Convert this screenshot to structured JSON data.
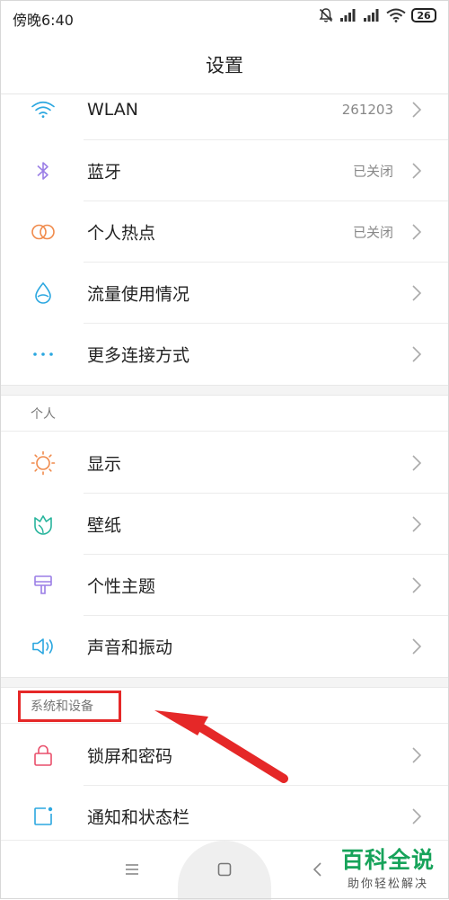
{
  "status_bar": {
    "time": "傍晚6:40",
    "battery": "26"
  },
  "header": {
    "title": "设置"
  },
  "sections": [
    {
      "header": "",
      "items": [
        {
          "icon": "wifi-icon",
          "label": "WLAN",
          "value": "261203"
        },
        {
          "icon": "bluetooth-icon",
          "label": "蓝牙",
          "value": "已关闭"
        },
        {
          "icon": "hotspot-icon",
          "label": "个人热点",
          "value": "已关闭"
        },
        {
          "icon": "data-usage-icon",
          "label": "流量使用情况",
          "value": ""
        },
        {
          "icon": "more-dots-icon",
          "label": "更多连接方式",
          "value": ""
        }
      ]
    },
    {
      "header": "个人",
      "items": [
        {
          "icon": "sun-icon",
          "label": "显示",
          "value": ""
        },
        {
          "icon": "wallpaper-icon",
          "label": "壁纸",
          "value": ""
        },
        {
          "icon": "theme-brush-icon",
          "label": "个性主题",
          "value": ""
        },
        {
          "icon": "speaker-icon",
          "label": "声音和振动",
          "value": ""
        }
      ]
    },
    {
      "header": "系统和设备",
      "items": [
        {
          "icon": "lock-icon",
          "label": "锁屏和密码",
          "value": ""
        },
        {
          "icon": "notification-icon",
          "label": "通知和状态栏",
          "value": ""
        }
      ]
    }
  ],
  "colors": {
    "wifi": "#2ba7e0",
    "bluetooth": "#9b7fe6",
    "hotspot": "#f08a4b",
    "data": "#2ba7e0",
    "more": "#2ba7e0",
    "sun": "#f08a4b",
    "wallpaper": "#27b49c",
    "theme": "#9b7fe6",
    "speaker": "#2ba7e0",
    "lock": "#e94f6b",
    "notification": "#2ba7e0",
    "highlight": "#e52828"
  },
  "nav_bar": {
    "menu": "menu-icon",
    "home": "home-icon",
    "back": "back-icon"
  },
  "watermark": {
    "brand": "百科全说",
    "tagline": "助你轻松解决"
  }
}
